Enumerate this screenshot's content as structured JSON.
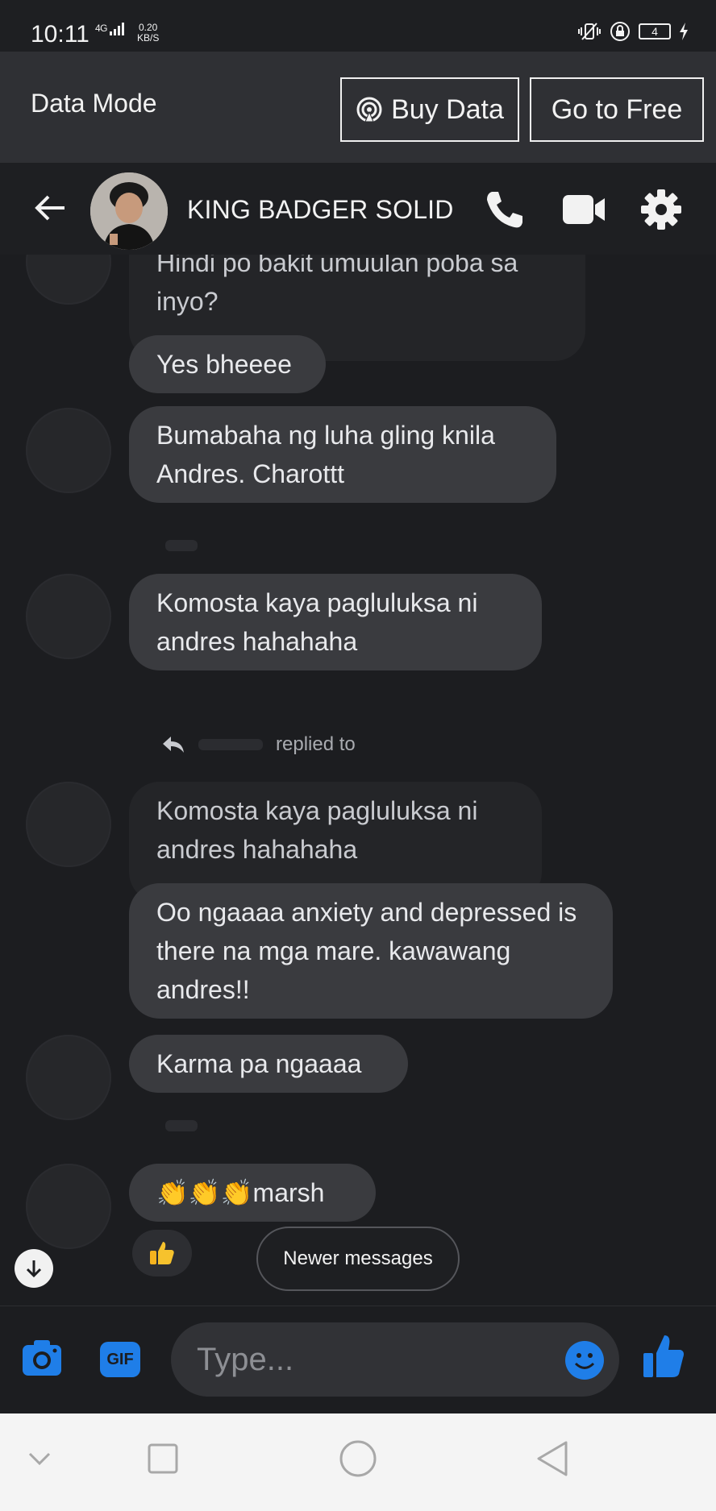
{
  "status": {
    "time": "10:11",
    "network": "4G",
    "speed_value": "0.20",
    "speed_unit": "KB/S",
    "battery": "4"
  },
  "data_mode": {
    "title": "Data Mode",
    "buy_label": "Buy Data",
    "free_label": "Go to Free"
  },
  "header": {
    "contact_name": "KING BADGER SOLID"
  },
  "messages": {
    "m1": "Hindi po bakit umuulan poba sa inyo?",
    "m2": "Yes bheeee",
    "m3": "Bumabaha ng luha gling knila Andres. Charottt",
    "m4": "Komosta kaya pagluluksa ni andres hahahaha",
    "reply_text": "replied to",
    "quoted": "Komosta kaya pagluluksa ni andres hahahaha",
    "m5": "Oo ngaaaa anxiety and depressed is there na mga mare. kawawang andres!!",
    "m6": "Karma pa ngaaaa",
    "m7_emoji": "👏👏👏",
    "m7_text": "marsh"
  },
  "newer_messages": "Newer messages",
  "composer": {
    "placeholder": "Type...",
    "gif_label": "GIF"
  },
  "colors": {
    "accent": "#1f7ee8",
    "bubble": "#3a3b3f",
    "background": "#1c1d20"
  }
}
